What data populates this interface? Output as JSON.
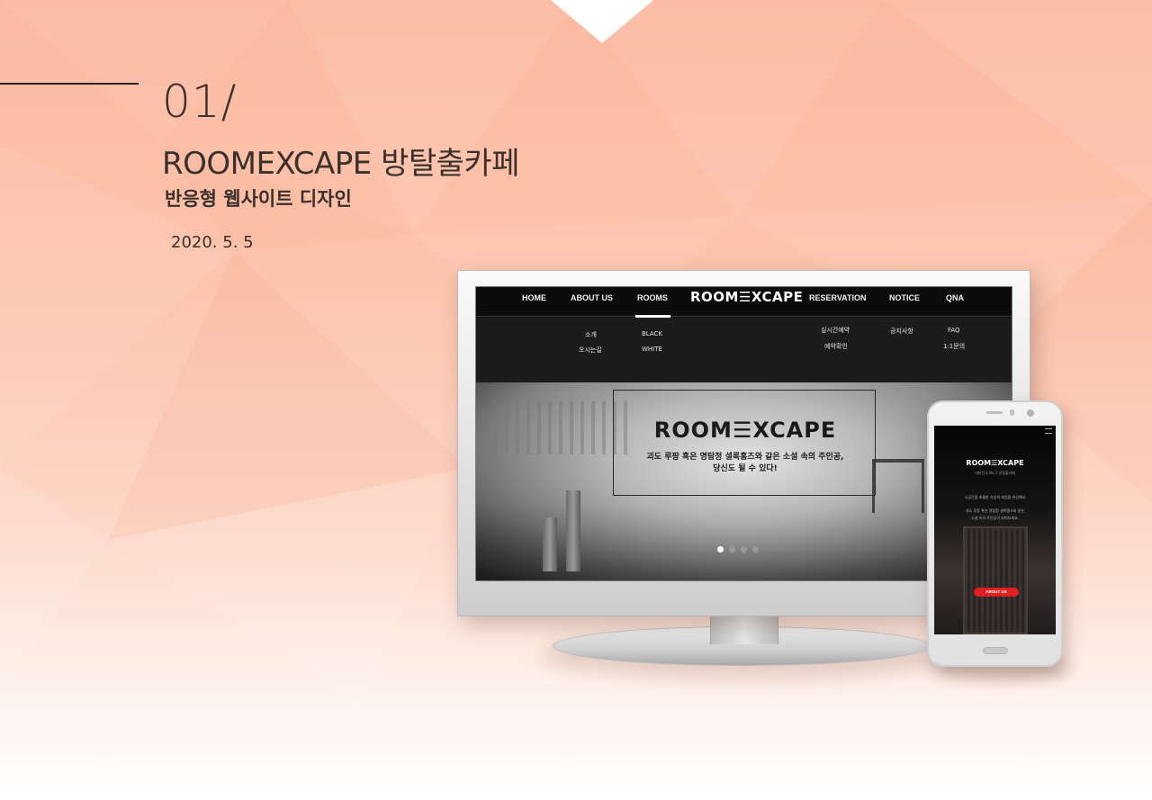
{
  "project": {
    "number": "01/",
    "title": "ROOMEXCAPE 방탈출카페",
    "subtitle": "반응형 웹사이트 디자인",
    "date": "2020. 5. 5"
  },
  "desktop_site": {
    "nav": {
      "home": "HOME",
      "about": "ABOUT US",
      "rooms": "ROOMS",
      "logo": "ROOM☰XCAPE",
      "reservation": "RESERVATION",
      "notice": "NOTICE",
      "qna": "QNA"
    },
    "submenu": {
      "intro": "소개",
      "directions": "오시는길",
      "black": "BLACK",
      "white": "WHITE",
      "realtime_booking": "실시간예약",
      "booking_check": "예약확인",
      "notice": "공지사항",
      "faq": "FAQ",
      "inquiry": "1:1문의"
    },
    "hero": {
      "logo": "ROOM☰XCAPE",
      "tagline_line1": "괴도 루팡 혹은 명탐정 셜록홈즈와 같은 소설 속의 주인공,",
      "tagline_line2": "당신도 될 수 있다!",
      "slides_total": 4,
      "active_slide": 1
    }
  },
  "mobile_site": {
    "logo": "ROOM☰XCAPE",
    "logo_sub": "대한민국 No.1 방탈출카페",
    "text_line1": "시공간을 초월한 가상의 게임을 완성해서",
    "text_line2": "괴도 루팡 혹은 명탐정 셜록홈즈와 같은",
    "text_line3": "소설 속의 주인공이 되어보세요.",
    "button_label": "ABOUT US"
  },
  "colors": {
    "background_peach": "#fbb9a0",
    "text_dark": "#3a302c",
    "button_red": "#e02020"
  }
}
